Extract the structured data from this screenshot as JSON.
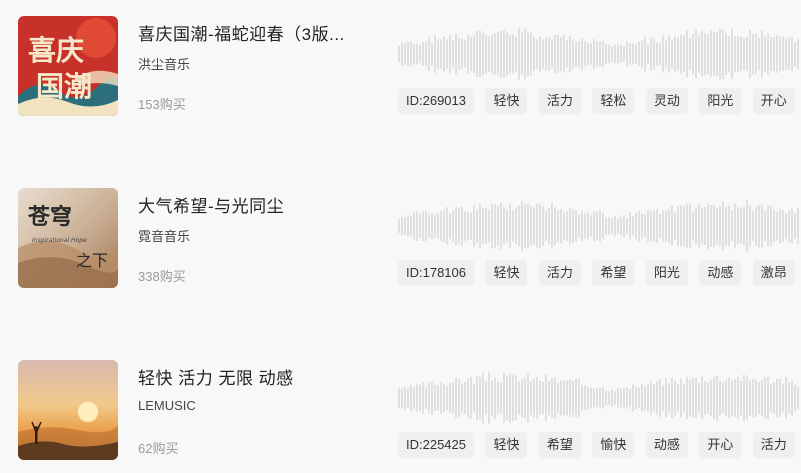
{
  "tracks": [
    {
      "title": "喜庆国潮-福蛇迎春（3版...",
      "artist": "洪尘音乐",
      "sales": "153购买",
      "cover_text": [
        "喜庆",
        "国潮"
      ],
      "id_tag": "ID:269013",
      "tags": [
        "轻快",
        "活力",
        "轻松",
        "灵动",
        "阳光",
        "开心"
      ]
    },
    {
      "title": "大气希望-与光同尘",
      "artist": "霓音音乐",
      "sales": "338购买",
      "cover_text": [
        "苍穹",
        "之下",
        "Inspirational Hope"
      ],
      "id_tag": "ID:178106",
      "tags": [
        "轻快",
        "活力",
        "希望",
        "阳光",
        "动感",
        "激昂"
      ]
    },
    {
      "title": "轻快 活力 无限 动感",
      "artist": "LEMUSIC",
      "sales": "62购买",
      "cover_text": [],
      "id_tag": "ID:225425",
      "tags": [
        "轻快",
        "希望",
        "愉快",
        "动感",
        "开心",
        "活力"
      ]
    }
  ],
  "colors": {
    "background": "#f8f8f8",
    "tag_bg": "#efefef",
    "waveform": "#c8c8c8",
    "sales_text": "#999999"
  }
}
